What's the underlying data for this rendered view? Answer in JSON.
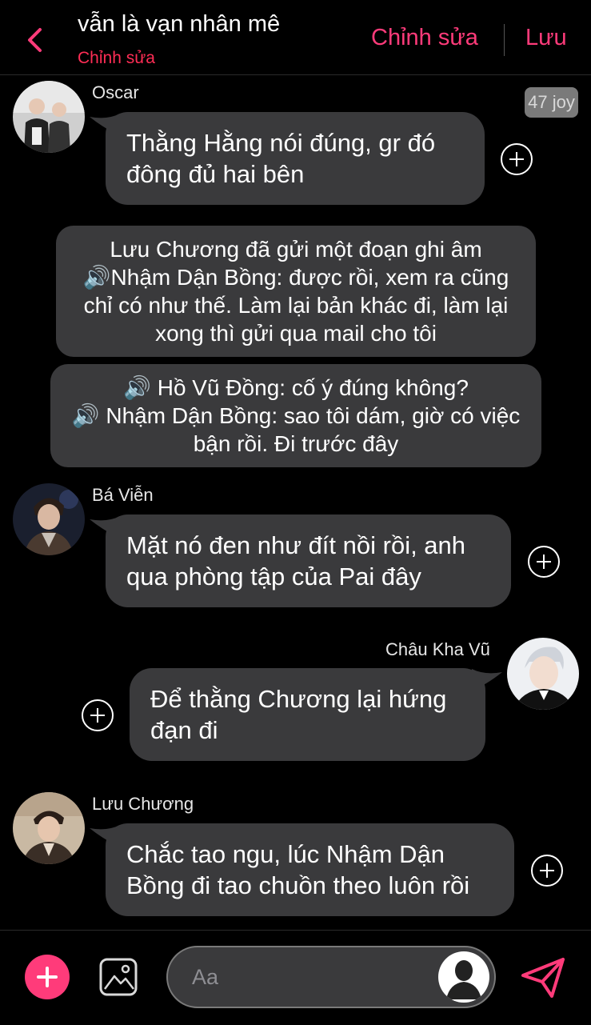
{
  "header": {
    "title": "vẫn là vạn nhân mê",
    "subtitle": "Chỉnh sửa",
    "edit_label": "Chỉnh sửa",
    "save_label": "Lưu"
  },
  "messages": [
    {
      "sender": "Oscar",
      "text": "Thằng Hằng nói đúng, gr đó đông đủ hai bên",
      "time_badge": "47 joy"
    },
    {
      "narration": [
        "Lưu Chương đã gửi một đoạn ghi âm",
        "🔊Nhậm Dận Bồng: được rồi, xem ra cũng chỉ có như thế. Làm lại bản khác đi, làm lại xong thì gửi qua mail cho tôi"
      ]
    },
    {
      "narration": [
        "🔊 Hồ Vũ Đồng: cố ý đúng không?",
        "🔊 Nhậm Dận Bồng: sao tôi dám, giờ có việc bận rồi. Đi trước đây"
      ]
    },
    {
      "sender": "Bá Viễn",
      "text": "Mặt nó đen như đít nồi rồi, anh qua phòng tập của Pai đây"
    },
    {
      "sender": "Châu Kha Vũ",
      "text": "Để thằng Chương lại hứng đạn đi"
    },
    {
      "sender": "Lưu Chương",
      "text": "Chắc tao ngu, lúc Nhậm Dận Bồng đi tao chuồn theo luôn rồi"
    }
  ],
  "composer": {
    "placeholder": "Aa"
  },
  "icons": {
    "back": "chevron-left-icon",
    "add": "plus-icon",
    "image": "image-icon",
    "send": "send-icon",
    "react": "plus-circle-icon"
  },
  "colors": {
    "accent": "#ff3b7a",
    "subtitle": "#ff2d55",
    "bubble": "#3a3a3c",
    "background": "#000000"
  }
}
